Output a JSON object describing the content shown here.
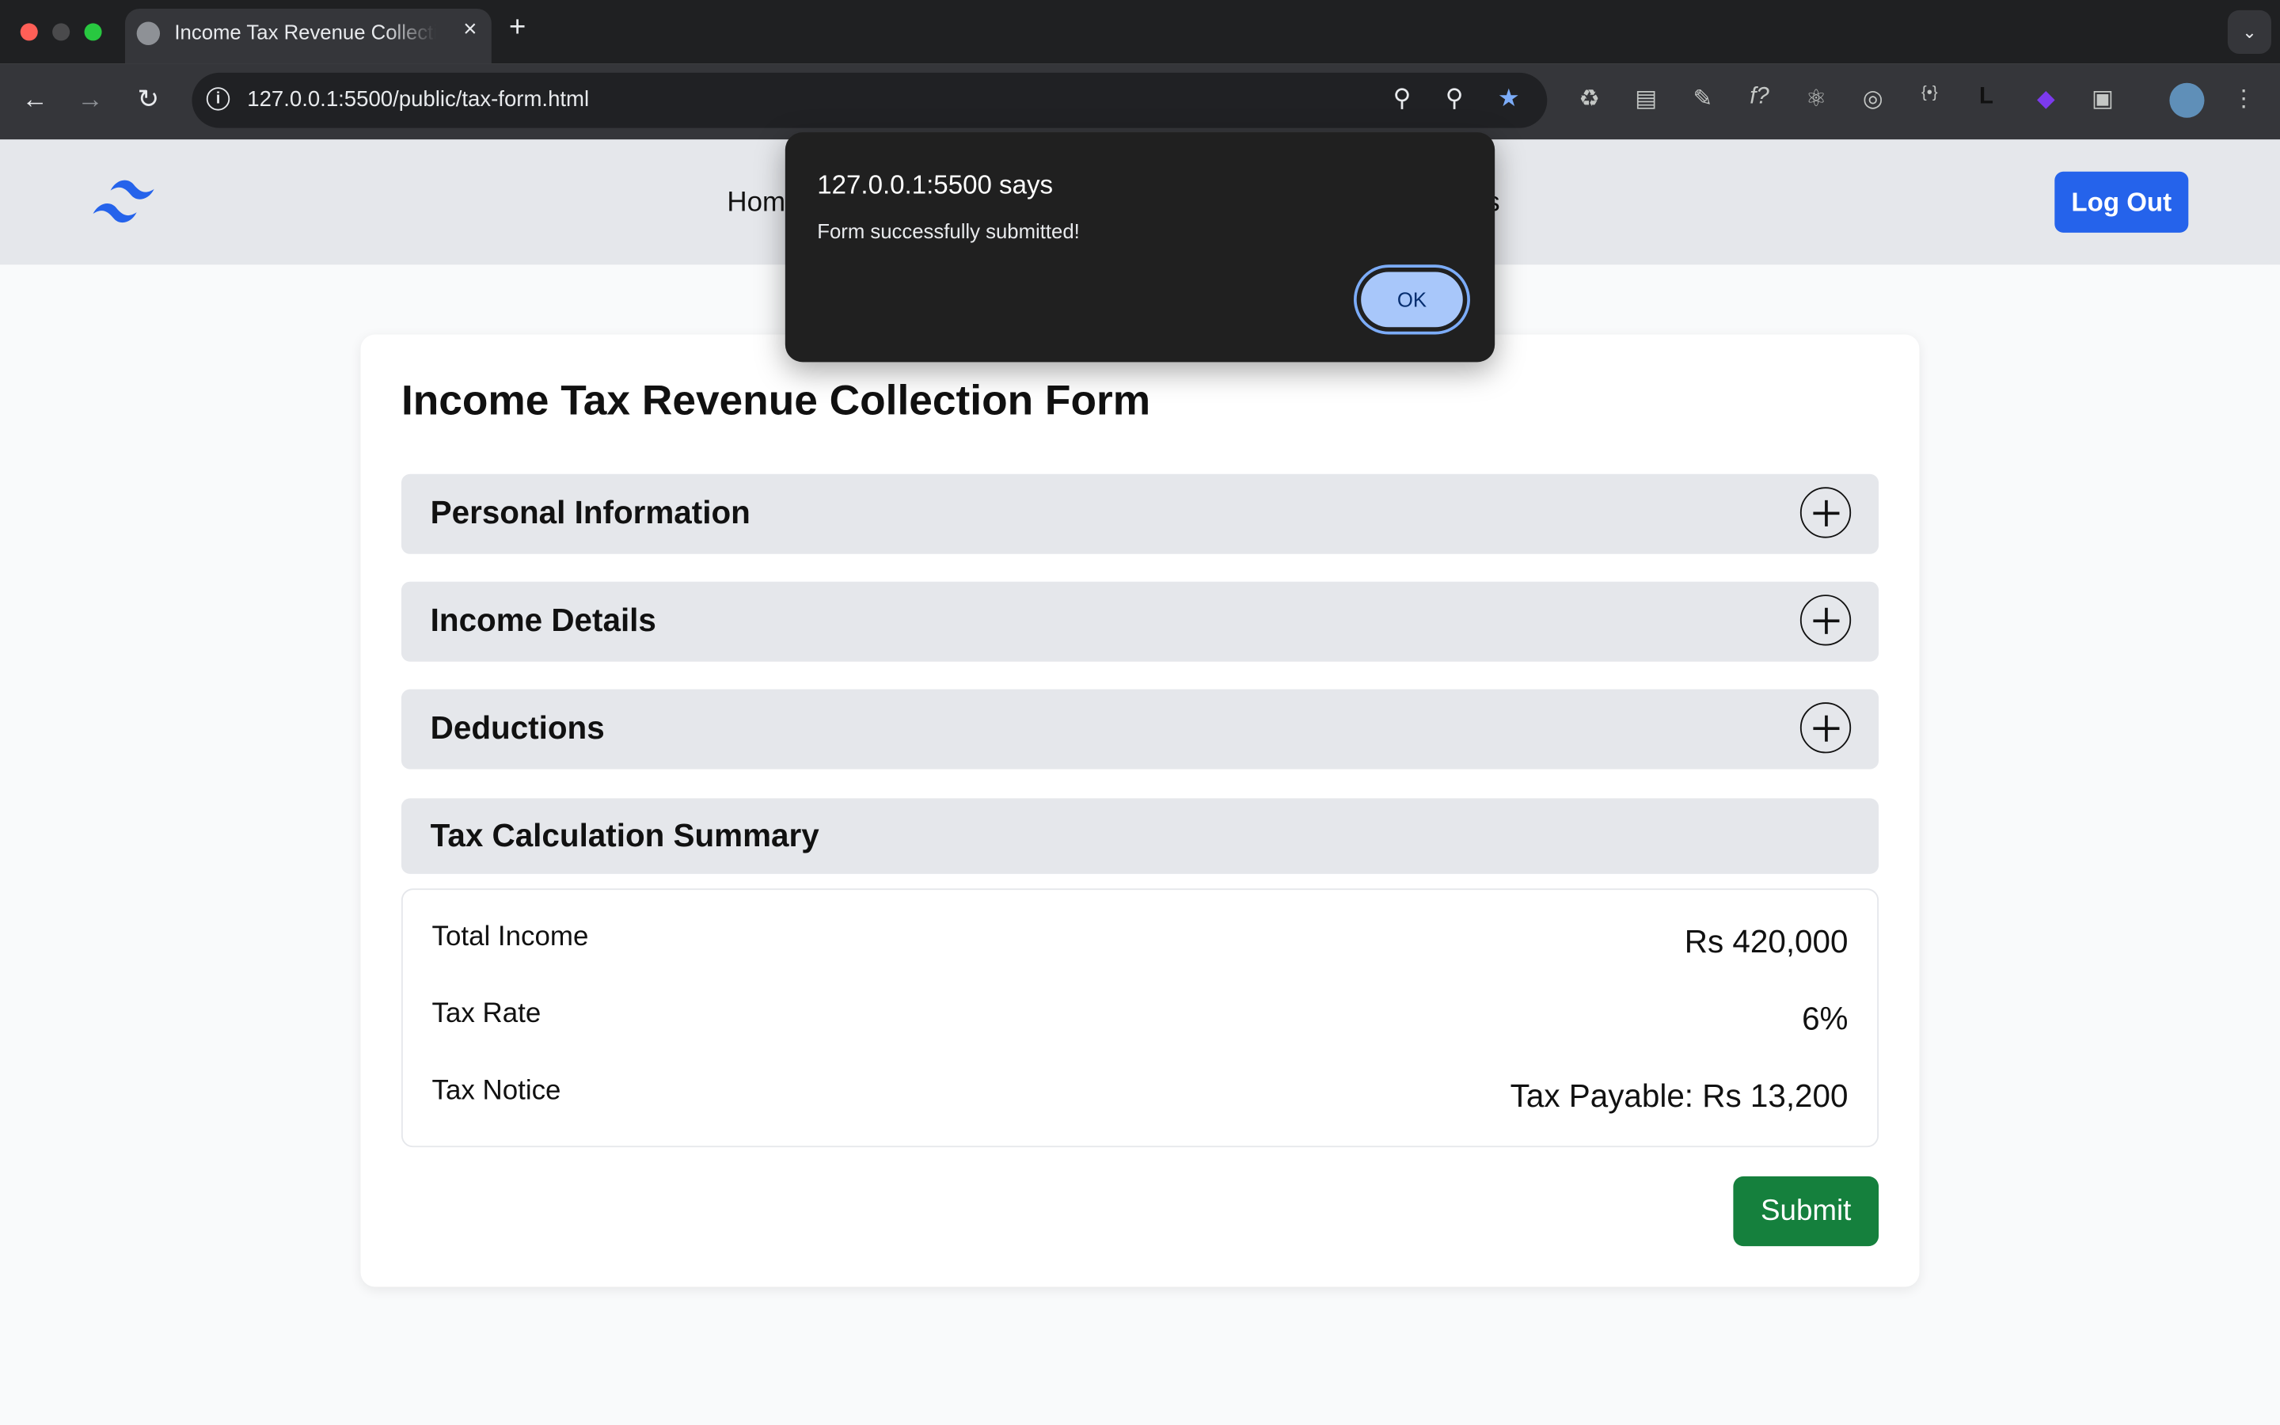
{
  "browser": {
    "tab_title": "Income Tax Revenue Collection Form",
    "tab_close": "×",
    "new_tab": "+",
    "url": "127.0.0.1:5500/public/tax-form.html"
  },
  "nav": {
    "links": [
      "Home",
      "s"
    ],
    "logout_label": "Log Out"
  },
  "form": {
    "title": "Income Tax Revenue Collection Form",
    "sections": [
      {
        "title": "Personal Information"
      },
      {
        "title": "Income Details"
      },
      {
        "title": "Deductions"
      },
      {
        "title": "Tax Calculation Summary"
      }
    ],
    "summary": {
      "total_income_label": "Total Income",
      "total_income_value": "Rs 420,000",
      "tax_rate_label": "Tax Rate",
      "tax_rate_value": "6%",
      "tax_notice_label": "Tax Notice",
      "tax_notice_value": "Tax Payable: Rs 13,200"
    },
    "submit_label": "Submit"
  },
  "dialog": {
    "title": "127.0.0.1:5500 says",
    "message": "Form successfully submitted!",
    "ok_label": "OK"
  },
  "colors": {
    "primary": "#2563eb",
    "success": "#15803d",
    "section_bg": "#e5e7eb"
  }
}
